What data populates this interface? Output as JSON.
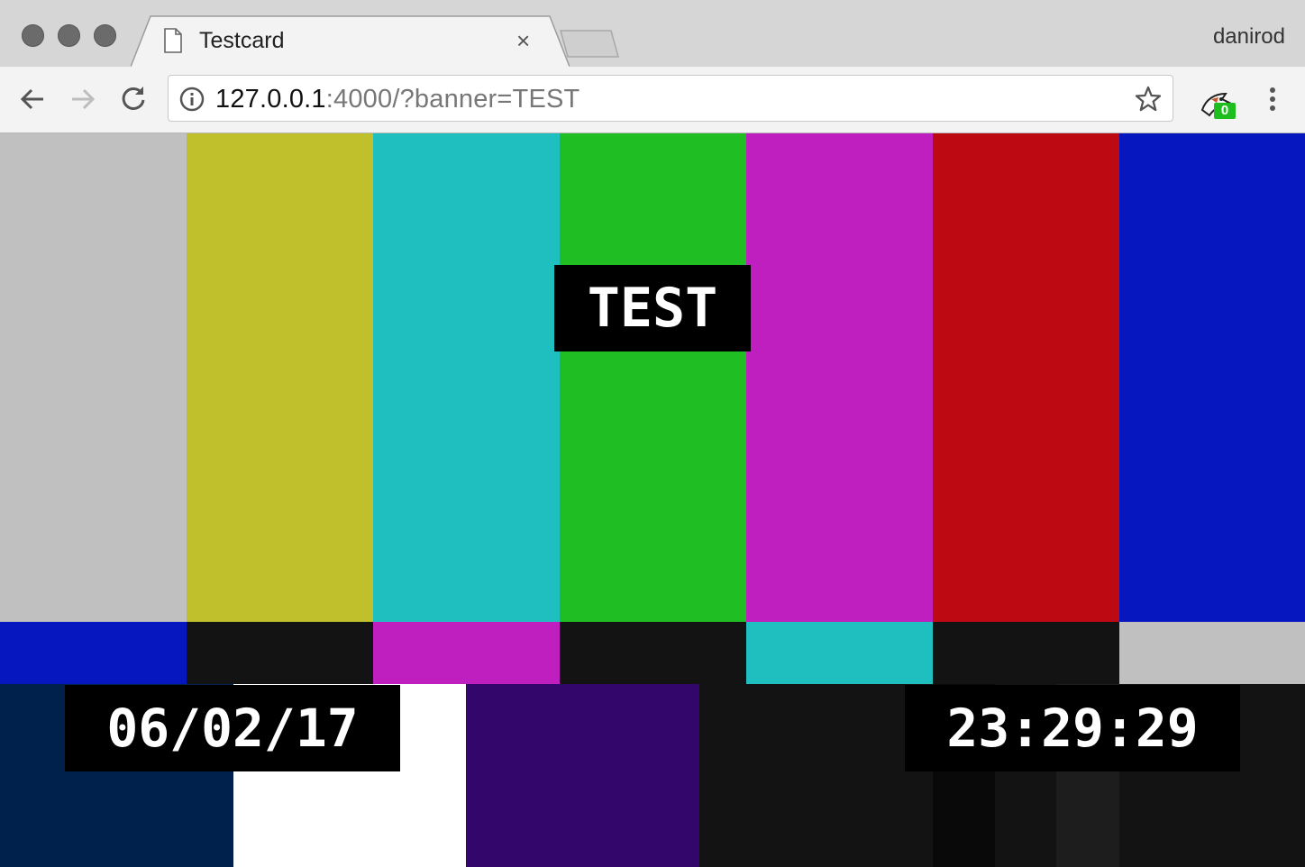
{
  "browser": {
    "tab": {
      "title": "Testcard",
      "close_label": "×"
    },
    "profile_name": "danirod",
    "address": {
      "host": "127.0.0.1",
      "rest": ":4000/?banner=TEST"
    },
    "extension_badge": "0",
    "traffic_light_color": "#6b6b6b"
  },
  "testcard": {
    "banner": "TEST",
    "date": "06/02/17",
    "time": "23:29:29",
    "top_bars": [
      "#c0c0c0",
      "#c0bf2c",
      "#20bfbf",
      "#1fbe22",
      "#bf1fbf",
      "#bd0a12",
      "#0617bf"
    ],
    "middle_bars": [
      "#0617bf",
      "#131313",
      "#bf1fbf",
      "#131313",
      "#20bfbf",
      "#131313",
      "#c0c0c0"
    ],
    "bottom_bars": [
      "#00214c",
      "#ffffff",
      "#32066a",
      "#131313",
      "#131313",
      "#090909",
      "#131313",
      "#1d1d1d",
      "#131313"
    ]
  }
}
